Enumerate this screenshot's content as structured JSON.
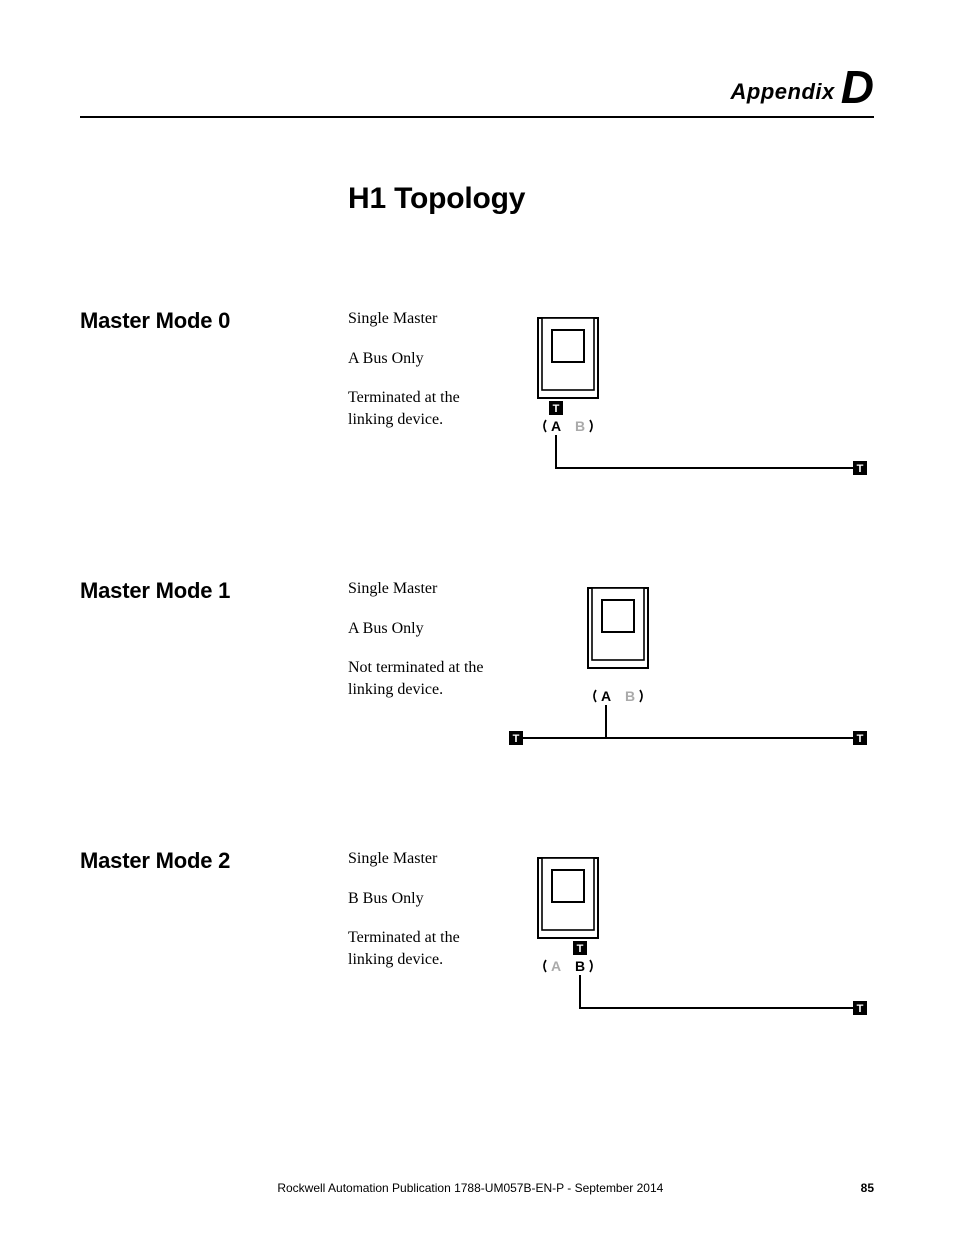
{
  "header": {
    "appendix_word": "Appendix",
    "appendix_letter": "D"
  },
  "chapter_title": "H1 Topology",
  "modes": [
    {
      "heading": "Master Mode 0",
      "lines": [
        "Single Master",
        "A Bus Only",
        "Terminated at the linking device."
      ],
      "diagram": {
        "port_a": "A",
        "port_b": "B",
        "t_on_port": "A",
        "left_terminator": false,
        "right_terminator": true,
        "active_port": "A"
      }
    },
    {
      "heading": "Master Mode 1",
      "lines": [
        "Single Master",
        "A Bus Only",
        "Not terminated at the linking device."
      ],
      "diagram": {
        "port_a": "A",
        "port_b": "B",
        "t_on_port": null,
        "left_terminator": true,
        "right_terminator": true,
        "active_port": "A"
      }
    },
    {
      "heading": "Master Mode 2",
      "lines": [
        "Single Master",
        "B Bus Only",
        "Terminated at the linking device."
      ],
      "diagram": {
        "port_a": "A",
        "port_b": "B",
        "t_on_port": "B",
        "left_terminator": false,
        "right_terminator": true,
        "active_port": "B"
      }
    }
  ],
  "footer": {
    "publication": "Rockwell Automation Publication 1788-UM057B-EN-P - September 2014",
    "page_number": "85"
  },
  "glyphs": {
    "T": "T"
  }
}
